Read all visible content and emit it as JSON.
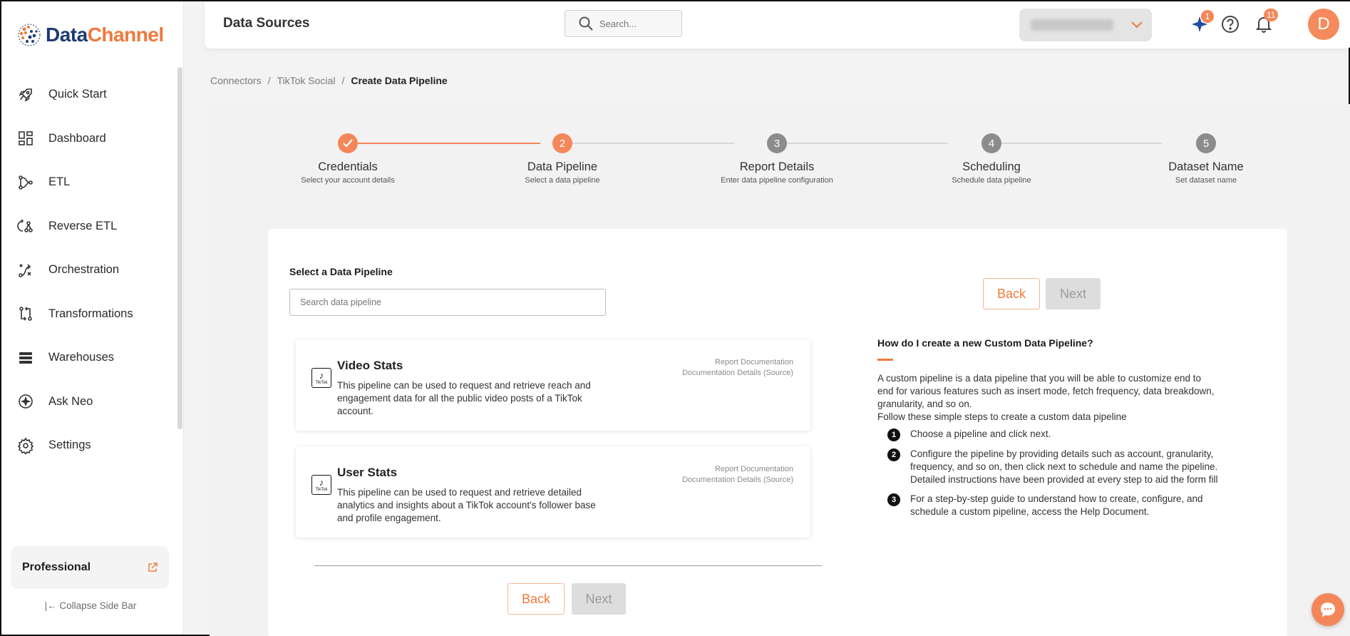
{
  "brand": {
    "name_part1": "Data",
    "name_part2": "Channel",
    "accent": "#f0793b",
    "navy": "#1f3b73"
  },
  "sidebar": {
    "items": [
      {
        "label": "Quick Start",
        "icon": "rocket-icon"
      },
      {
        "label": "Dashboard",
        "icon": "dashboard-icon"
      },
      {
        "label": "ETL",
        "icon": "etl-icon"
      },
      {
        "label": "Reverse ETL",
        "icon": "reverse-etl-icon"
      },
      {
        "label": "Orchestration",
        "icon": "orchestration-icon"
      },
      {
        "label": "Transformations",
        "icon": "transformations-icon"
      },
      {
        "label": "Warehouses",
        "icon": "warehouses-icon"
      },
      {
        "label": "Ask Neo",
        "icon": "sparkle-icon"
      },
      {
        "label": "Settings",
        "icon": "gear-icon"
      }
    ],
    "plan_label": "Professional",
    "collapse_label": "Collapse Side Bar"
  },
  "header": {
    "title": "Data Sources",
    "search_placeholder": "Search...",
    "ai_badge": "1",
    "notifications_badge": "11",
    "avatar_initial": "D"
  },
  "breadcrumb": {
    "items": [
      "Connectors",
      "TikTok Social"
    ],
    "current": "Create Data Pipeline"
  },
  "stepper": {
    "steps": [
      {
        "title": "Credentials",
        "subtitle": "Select your account details",
        "number": "1",
        "state": "done"
      },
      {
        "title": "Data Pipeline",
        "subtitle": "Select a data pipeline",
        "number": "2",
        "state": "active"
      },
      {
        "title": "Report Details",
        "subtitle": "Enter data pipeline configuration",
        "number": "3",
        "state": "pending"
      },
      {
        "title": "Scheduling",
        "subtitle": "Schedule data pipeline",
        "number": "4",
        "state": "pending"
      },
      {
        "title": "Dataset Name",
        "subtitle": "Set dataset name",
        "number": "5",
        "state": "pending"
      }
    ]
  },
  "main": {
    "select_label": "Select a Data Pipeline",
    "search_placeholder": "Search data pipeline",
    "back_label": "Back",
    "next_label": "Next",
    "pipelines": [
      {
        "title": "Video Stats",
        "description": "This pipeline can be used to request and retrieve reach and engagement data for all the public video posts of a TikTok account.",
        "link1": "Report Documentation",
        "link2": "Documentation Details (Source)",
        "logo_text": "TikTok"
      },
      {
        "title": "User Stats",
        "description": "This pipeline can be used to request and retrieve detailed analytics and insights about a TikTok account's follower base and profile engagement.",
        "link1": "Report Documentation",
        "link2": "Documentation Details (Source)",
        "logo_text": "TikTok"
      }
    ]
  },
  "help": {
    "title": "How do I create a new Custom Data Pipeline?",
    "intro": "A custom pipeline is a data pipeline that you will be able to customize end to end for various features such as insert mode, fetch frequency, data breakdown, granularity, and so on.",
    "intro2": "Follow these simple steps to create a custom data pipeline",
    "steps": [
      {
        "num": "1",
        "text": "Choose a pipeline and click next."
      },
      {
        "num": "2",
        "text": "Configure the pipeline by providing details such as account, granularity, frequency, and so on, then click next to schedule and name the pipeline. Detailed instructions have been provided at every step to aid the form fill"
      },
      {
        "num": "3",
        "text": "For a step-by-step guide to understand how to create, configure, and schedule a custom pipeline, access the Help Document."
      }
    ]
  }
}
